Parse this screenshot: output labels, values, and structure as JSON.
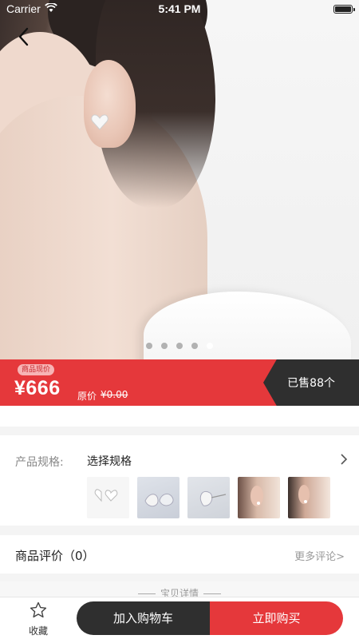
{
  "status_bar": {
    "carrier": "Carrier",
    "time": "5:41 PM"
  },
  "carousel": {
    "dot_count": 5,
    "active_index": 4
  },
  "price": {
    "tag": "商品现价",
    "current": "¥666",
    "original_label": "原价",
    "original_value": "¥0.00",
    "sold": "已售88个"
  },
  "spec": {
    "label": "产品规格:",
    "value": "选择规格",
    "thumbnails": [
      "earring-pair",
      "earring-angle",
      "earring-single",
      "ear-model-1",
      "ear-model-2"
    ]
  },
  "reviews": {
    "title": "商品评价（0）",
    "more": "更多评论>"
  },
  "details": {
    "title": "宝贝详情"
  },
  "bottom_bar": {
    "favorite_label": "收藏",
    "add_to_cart": "加入购物车",
    "buy_now": "立即购买"
  },
  "colors": {
    "accent": "#e5383b",
    "dark": "#2f2f2f"
  }
}
